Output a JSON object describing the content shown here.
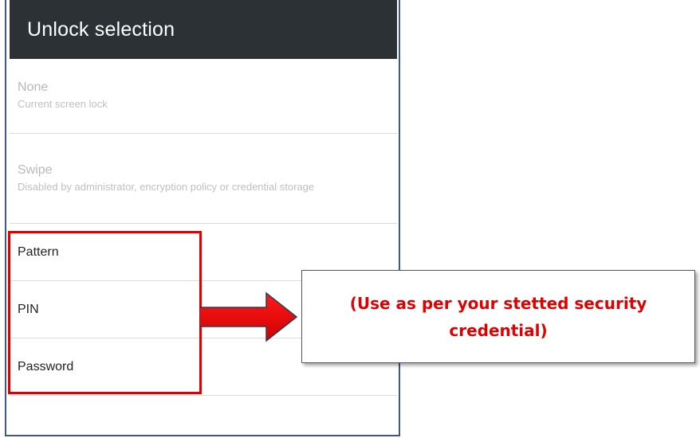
{
  "header": {
    "title": "Unlock selection"
  },
  "options": [
    {
      "title": "None",
      "subtitle": "Current screen lock",
      "disabled": true
    },
    {
      "title": "Swipe",
      "subtitle": "Disabled by administrator, encryption policy or credential storage",
      "disabled": true
    },
    {
      "title": "Pattern",
      "subtitle": "",
      "disabled": false
    },
    {
      "title": "PIN",
      "subtitle": "",
      "disabled": false
    },
    {
      "title": "Password",
      "subtitle": "",
      "disabled": false
    }
  ],
  "annotation": {
    "callout_text": "(Use as per your stetted security credential)",
    "highlight_color": "#e00000",
    "arrow_color": "#e00000"
  },
  "colors": {
    "header_bg": "#2c3136",
    "disabled_text": "#b8b8b8"
  }
}
